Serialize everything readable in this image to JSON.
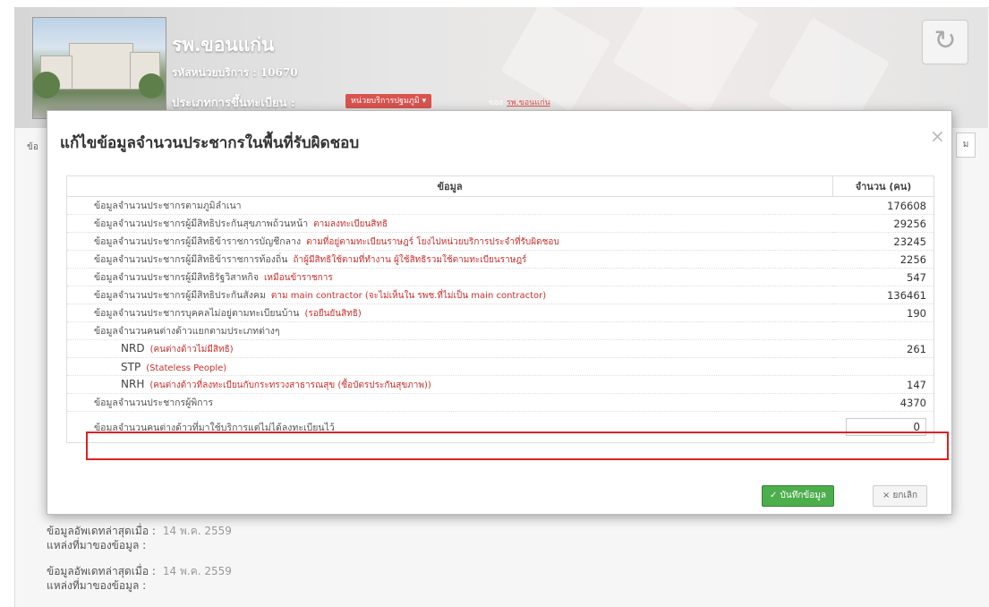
{
  "header": {
    "hospital_name": "รพ.ขอนแก่น",
    "service_code": "รหัสหน่วยบริการ : 10670",
    "registration_type_label": "ประเภทการขึ้นทะเบียน :",
    "registration_type_value": "หน่วยบริการปฐมภูมิ",
    "owner_label": "ของ",
    "owner_link": "รพ.ขอนแก่น"
  },
  "background": {
    "tab_left": "ข้อ",
    "tab_right": "ม",
    "updates": [
      {
        "label": "ข้อมูลอัพเดทล่าสุดเมื่อ :",
        "value": "14 พ.ค. 2559",
        "source_label": "แหล่งที่มาของข้อมูล :"
      },
      {
        "label": "ข้อมูลอัพเดทล่าสุดเมื่อ :",
        "value": "14 พ.ค. 2559",
        "source_label": "แหล่งที่มาของข้อมูล :"
      }
    ]
  },
  "modal": {
    "title": "แก้ไขข้อมูลจำนวนประชากรในพื้นที่รับผิดชอบ",
    "close": "×",
    "table": {
      "headers": [
        "ข้อมูล",
        "จำนวน (คน)"
      ],
      "rows": [
        {
          "label": "ข้อมูลจำนวนประชากรตามภูมิลำเนา",
          "note": "",
          "value": "176608"
        },
        {
          "label": "ข้อมูลจำนวนประชากรผู้มีสิทธิประกันสุขภาพถ้วนหน้า",
          "note": "ตามลงทะเบียนสิทธิ",
          "value": "29256"
        },
        {
          "label": "ข้อมูลจำนวนประชากรผู้มีสิทธิข้าราชการบัญชีกลาง",
          "note": "ตามที่อยู่ตามทะเบียนราษฎร์ โยงไปหน่วยบริการประจำที่รับผิดชอบ",
          "value": "23245"
        },
        {
          "label": "ข้อมูลจำนวนประชากรผู้มีสิทธิข้าราชการท้องถิ่น",
          "note": "ถ้าผู้มีสิทธิใช้ตามที่ทำงาน ผู้ใช้สิทธิรวมใช้ตามทะเบียนราษฎร์",
          "value": "2256"
        },
        {
          "label": "ข้อมูลจำนวนประชากรผู้มีสิทธิรัฐวิสาหกิจ",
          "note": "เหมือนข้าราชการ",
          "value": "547"
        },
        {
          "label": "ข้อมูลจำนวนประชากรผู้มีสิทธิประกันสังคม",
          "note": "ตาม main contractor (จะไม่เห็นใน รพช.ที่ไม่เป็น main contractor)",
          "value": "136461"
        },
        {
          "label": "ข้อมูลจำนวนประชากรบุคคลไม่อยู่ตามทะเบียนบ้าน",
          "note": "(รอยืนยันสิทธิ)",
          "value": "190"
        },
        {
          "label": "ข้อมูลจำนวนคนต่างด้าวแยกตามประเภทต่างๆ",
          "note": "",
          "value": ""
        },
        {
          "label": "NRD",
          "note": "(คนต่างด้าวไม่มีสิทธิ)",
          "value": "261",
          "sub": true
        },
        {
          "label": "STP",
          "note": "(Stateless People)",
          "value": "",
          "sub": true
        },
        {
          "label": "NRH",
          "note": "(คนต่างด้าวที่ลงทะเบียนกับกระทรวงสาธารณสุข (ซื้อบัตรประกันสุขภาพ))",
          "value": "147",
          "sub": true
        },
        {
          "label": "ข้อมูลจำนวนประชากรผู้พิการ",
          "note": "",
          "value": "4370"
        }
      ],
      "edit_row": {
        "label": "ข้อมูลจำนวนคนต่างด้าวที่มาใช้บริการแต่ไม่ได้ลงทะเบียนไว้",
        "value": "0"
      }
    },
    "save_label": "✓ บันทึกข้อมูล",
    "cancel_label": "× ยกเลิก"
  },
  "colors": {
    "accent_red": "#d9534f",
    "save_green": "#4cae4c",
    "highlight_red": "#e02020"
  }
}
